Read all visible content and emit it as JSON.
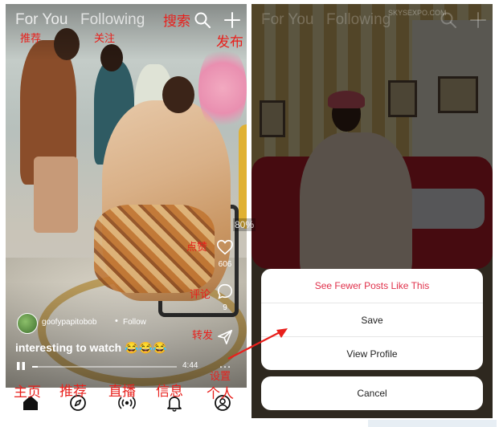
{
  "left_panel": {
    "tabs": {
      "for_you": "For You",
      "following": "Following"
    },
    "author": {
      "name": "goofypapitobob",
      "follow_label": "Follow",
      "separator": "•"
    },
    "caption": "interesting to watch 😂😂😂",
    "rail": {
      "likes": "606",
      "comments": "9"
    },
    "player": {
      "time": "4:44",
      "progress_fraction": 0.04
    },
    "more_label": "…"
  },
  "annotations": {
    "recommend_top": "推荐",
    "follow_top": "关注",
    "search": "搜索",
    "publish": "发布",
    "like": "点赞",
    "comment": "评论",
    "share": "转发",
    "settings": "设置",
    "nav_home": "主页",
    "nav_recommend": "推荐",
    "nav_live": "直播",
    "nav_messages": "信息",
    "nav_profile": "个人"
  },
  "right_panel": {
    "tabs": {
      "for_you": "For You",
      "following": "Following"
    },
    "watermark": "SKYSEXPO.COM",
    "action_sheet": {
      "items": [
        "See Fewer Posts Like This",
        "Save",
        "View Profile"
      ],
      "cancel": "Cancel"
    }
  },
  "overlay": {
    "zoom": "80%"
  },
  "colors": {
    "annotation": "#e8201c",
    "destructive": "#e0304a",
    "accent_sofa": "#b81f2a"
  },
  "icons": [
    "search-icon",
    "plus-icon",
    "heart-icon",
    "comment-icon",
    "share-icon",
    "pause-icon",
    "home-icon",
    "compass-icon",
    "live-icon",
    "bell-icon",
    "profile-icon"
  ]
}
